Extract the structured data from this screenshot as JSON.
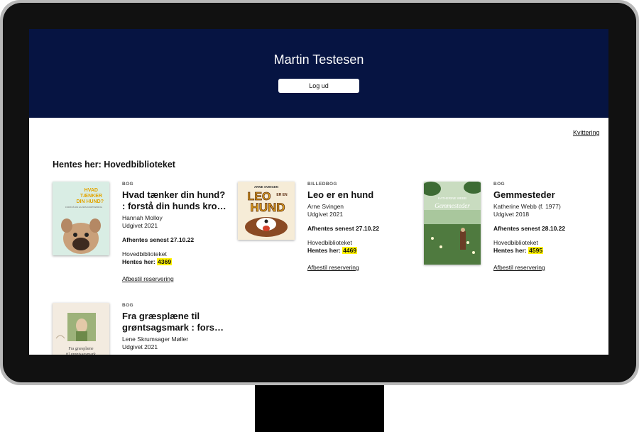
{
  "header": {
    "user_name": "Martin Testesen",
    "logout_label": "Log ud"
  },
  "receipt_link": "Kvittering",
  "pickup_heading": "Hentes her: Hovedbiblioteket",
  "reservations": [
    {
      "type": "BOG",
      "title_line1": "Hvad tænker din hund?",
      "title_line2": ": forstå din hunds kro…",
      "author": "Hannah Molloy",
      "published": "Udgivet 2021",
      "deadline": "Afhentes senest 27.10.22",
      "branch": "Hovedbiblioteket",
      "pickup_label": "Hentes her:",
      "pickup_code": "4369",
      "cancel_label": "Afbestil reservering",
      "cover": {
        "text_line1": "HVAD",
        "text_line2": "TÆNKER",
        "text_line3": "DIN HUND?",
        "small": "FORSTÅ DIN HUNDS KROPSSPROG",
        "bg": "#d9ede4"
      }
    },
    {
      "type": "BILLEDBOG",
      "title_line1": "Leo er en hund",
      "title_line2": "",
      "author": "Arne Svingen",
      "published": "Udgivet 2021",
      "deadline": "Afhentes senest 27.10.22",
      "branch": "Hovedbiblioteket",
      "pickup_label": "Hentes her:",
      "pickup_code": "4469",
      "cancel_label": "Afbestil reservering",
      "cover": {
        "author": "ARNE SVINGEN",
        "text_line1": "LEO",
        "text_line2": "ER EN",
        "text_line3": "HUND",
        "bg": "#f6ecd7"
      }
    },
    {
      "type": "BOG",
      "title_line1": "Gemmesteder",
      "title_line2": "",
      "author": "Katherine Webb (f. 1977)",
      "published": "Udgivet 2018",
      "deadline": "Afhentes senest 28.10.22",
      "branch": "Hovedbiblioteket",
      "pickup_label": "Hentes her:",
      "pickup_code": "4595",
      "cancel_label": "Afbestil reservering",
      "cover": {
        "author": "KATHERINE WEBB",
        "text_line1": "Gemmesteder",
        "bg": "#8fb08a"
      }
    },
    {
      "type": "BOG",
      "title_line1": "Fra græsplæne til",
      "title_line2": "grøntsagsmark : fors…",
      "author": "Lene Skrumsager Møller",
      "published": "Udgivet 2021",
      "cover": {
        "text_line1": "Fra græsplæne",
        "text_line2": "til grøntsagsmark",
        "bg": "#f3ebe0"
      }
    }
  ]
}
